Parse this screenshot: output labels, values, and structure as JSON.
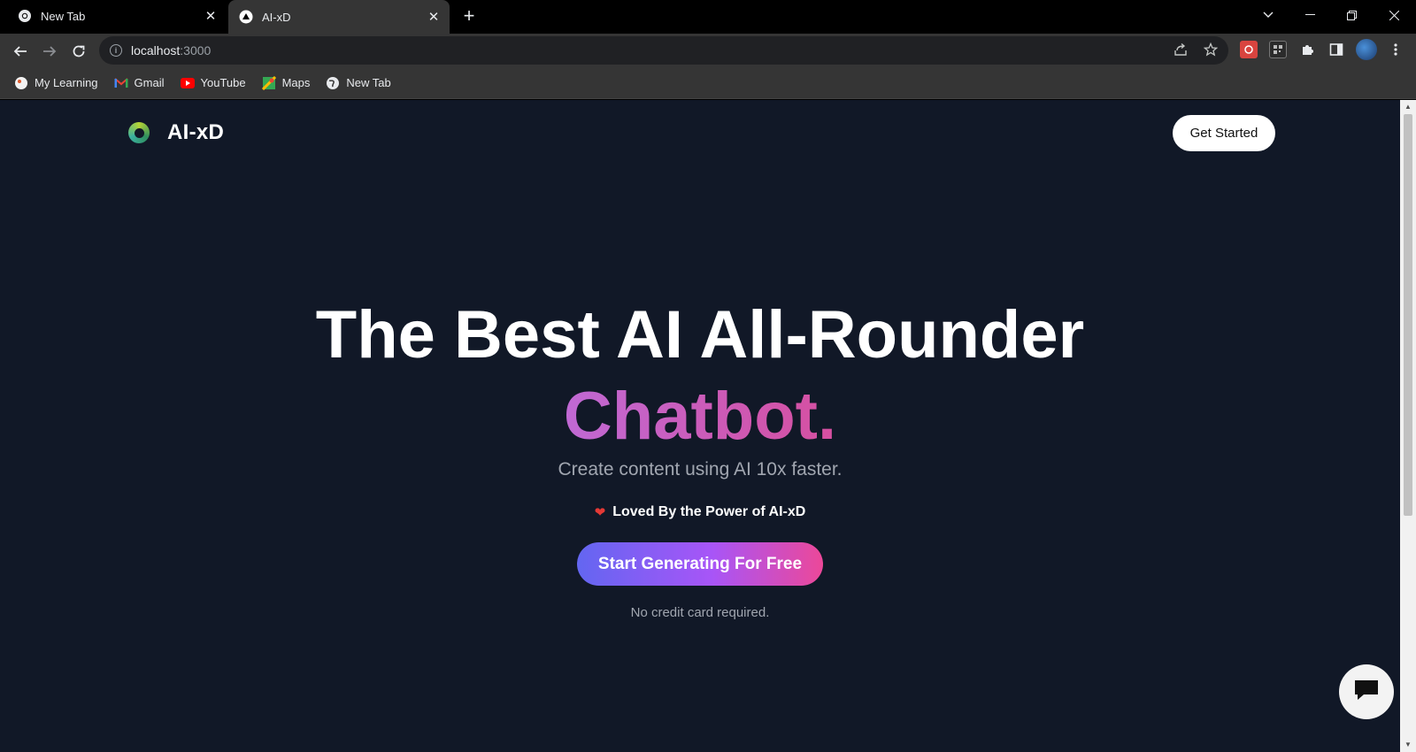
{
  "browser": {
    "tabs": [
      {
        "title": "New Tab",
        "active": false,
        "icon": "chrome-icon"
      },
      {
        "title": "AI-xD",
        "active": true,
        "icon": "triangle-icon"
      }
    ],
    "url_host": "localhost",
    "url_port": ":3000",
    "bookmarks": [
      {
        "label": "My Learning",
        "icon": "my-learning-icon"
      },
      {
        "label": "Gmail",
        "icon": "gmail-icon"
      },
      {
        "label": "YouTube",
        "icon": "youtube-icon"
      },
      {
        "label": "Maps",
        "icon": "maps-icon"
      },
      {
        "label": "New Tab",
        "icon": "globe-icon"
      }
    ]
  },
  "site": {
    "brand": "AI-xD",
    "nav_cta": "Get Started",
    "hero_title": "The Best AI All-Rounder",
    "hero_accent": "Chatbot.",
    "subtitle": "Create content using AI 10x faster.",
    "loved_text": "Loved By the Power of AI-xD",
    "cta_label": "Start Generating For Free",
    "note": "No credit card required."
  },
  "colors": {
    "page_bg": "#111827",
    "accent_start": "#6366f1",
    "accent_end": "#ec4899",
    "chatbot_gradient": [
      "#c069d4",
      "#d64fa0"
    ]
  }
}
